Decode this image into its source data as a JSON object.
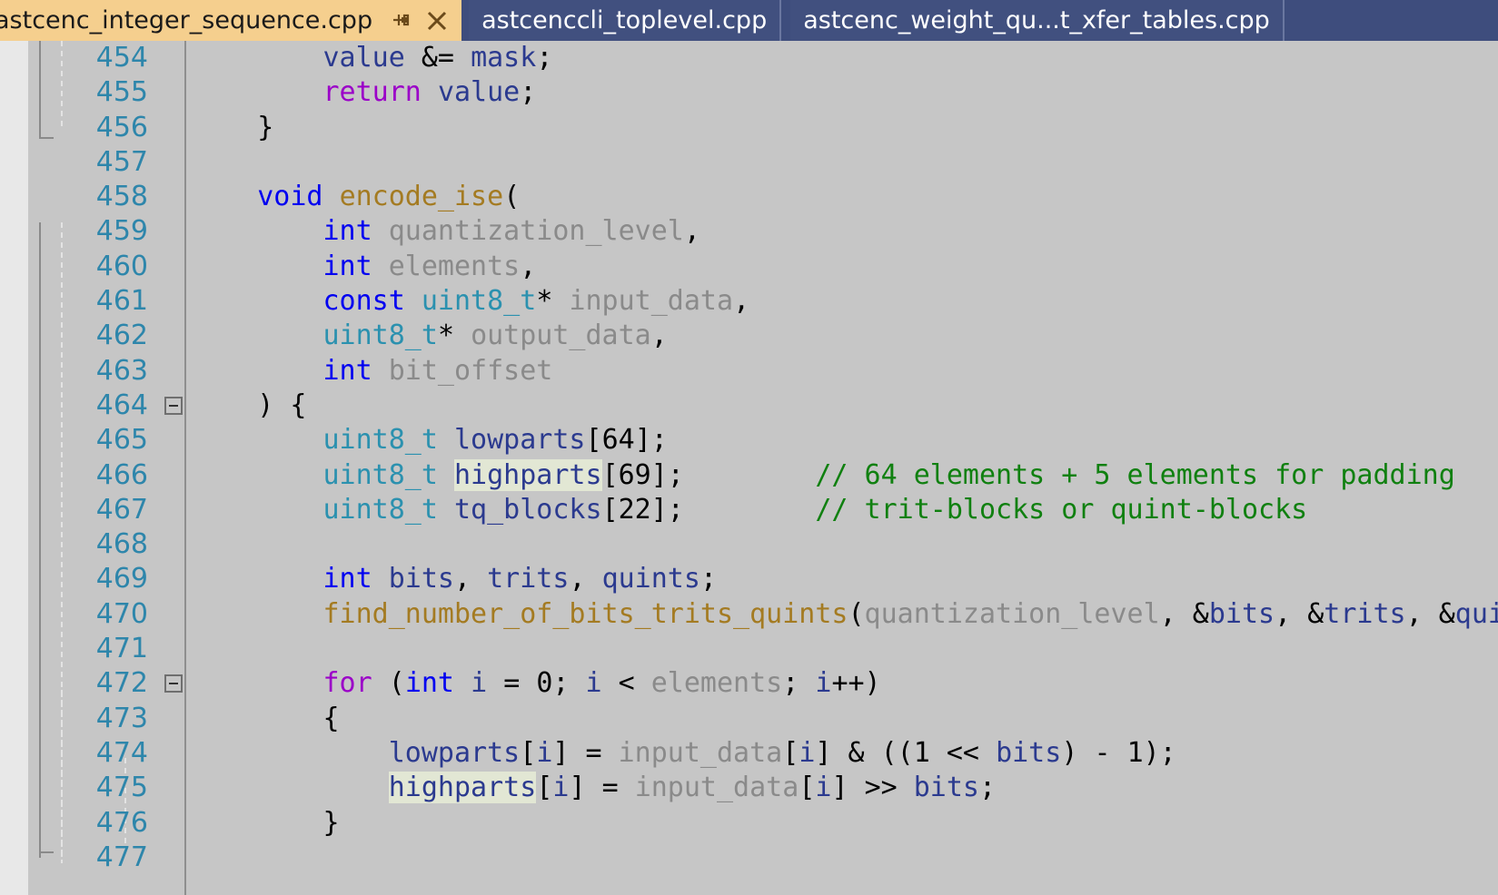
{
  "window": {
    "accent_tab_active_bg": "#f5cf8e",
    "accent_tab_inactive_bg": "#41507f",
    "tabbar_bg": "#3e4d7d",
    "editor_bg": "#c6c6c6",
    "linenumber_color": "#2e86ab",
    "comment_color": "#108010",
    "keyword_color": "#0000f0",
    "type_color": "#2b91af",
    "function_color": "#a47b22",
    "parameter_color": "#8a8a8a",
    "highlight_color": "#e2e7d4"
  },
  "tabs": [
    {
      "label": "astcenc_integer_sequence.cpp",
      "active": true,
      "pin_icon": "pin-icon",
      "close_icon": "close-icon"
    },
    {
      "label": "astcenccli_toplevel.cpp",
      "active": false
    },
    {
      "label": "astcenc_weight_qu...t_xfer_tables.cpp",
      "active": false
    }
  ],
  "editor": {
    "first_line": 454,
    "lines": [
      {
        "n": "454",
        "text": "        value &= mask;"
      },
      {
        "n": "455",
        "text": "        return value;"
      },
      {
        "n": "456",
        "text": "    }"
      },
      {
        "n": "457",
        "text": ""
      },
      {
        "n": "458",
        "text": "    void encode_ise("
      },
      {
        "n": "459",
        "text": "        int quantization_level,"
      },
      {
        "n": "460",
        "text": "        int elements,"
      },
      {
        "n": "461",
        "text": "        const uint8_t* input_data,"
      },
      {
        "n": "462",
        "text": "        uint8_t* output_data,"
      },
      {
        "n": "463",
        "text": "        int bit_offset"
      },
      {
        "n": "464",
        "text": "    ) {",
        "fold": true
      },
      {
        "n": "465",
        "text": "        uint8_t lowparts[64];"
      },
      {
        "n": "466",
        "text": "        uint8_t highparts[69];        // 64 elements + 5 elements for padding"
      },
      {
        "n": "467",
        "text": "        uint8_t tq_blocks[22];        // trit-blocks or quint-blocks"
      },
      {
        "n": "468",
        "text": ""
      },
      {
        "n": "469",
        "text": "        int bits, trits, quints;"
      },
      {
        "n": "470",
        "text": "        find_number_of_bits_trits_quints(quantization_level, &bits, &trits, &quints);"
      },
      {
        "n": "471",
        "text": ""
      },
      {
        "n": "472",
        "text": "        for (int i = 0; i < elements; i++)",
        "fold": true
      },
      {
        "n": "473",
        "text": "        {"
      },
      {
        "n": "474",
        "text": "            lowparts[i] = input_data[i] & ((1 << bits) - 1);"
      },
      {
        "n": "475",
        "text": "            highparts[i] = input_data[i] >> bits;"
      },
      {
        "n": "476",
        "text": "        }"
      },
      {
        "n": "477",
        "text": ""
      }
    ],
    "highlighted_word": "highparts"
  }
}
